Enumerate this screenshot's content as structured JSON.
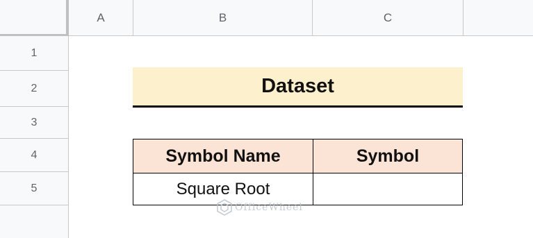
{
  "columns": [
    "A",
    "B",
    "C"
  ],
  "rows": [
    "1",
    "2",
    "3",
    "4",
    "5"
  ],
  "title": "Dataset",
  "table": {
    "headers": [
      "Symbol Name",
      "Symbol"
    ],
    "rows": [
      [
        "Square Root",
        ""
      ]
    ]
  },
  "watermark": "OfficeWheel",
  "colors": {
    "title_bg": "#fdf0cc",
    "header_bg": "#fbe4d5",
    "grid_header_bg": "#f8f9fa"
  }
}
